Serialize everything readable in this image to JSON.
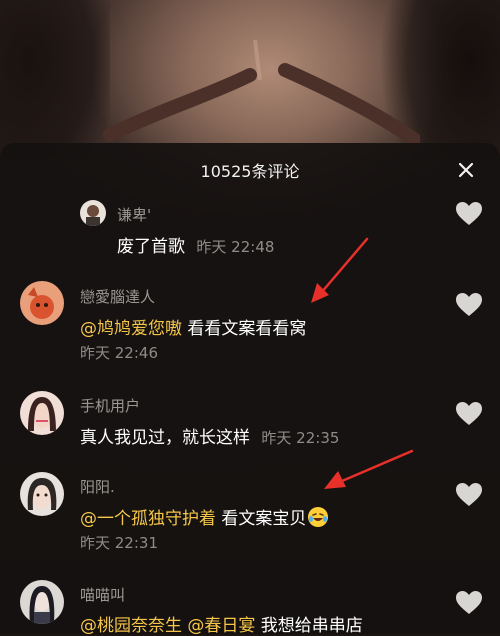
{
  "header": {
    "title": "10525条评论",
    "close_icon": "close-icon"
  },
  "comments": [
    {
      "user": "谦卑'",
      "parts": [
        {
          "text": "废了首歌",
          "mention": false
        }
      ],
      "time": "昨天 22:48",
      "time_inline": true
    },
    {
      "user": "戀愛腦達人",
      "parts": [
        {
          "text": "@鸠鸠爱您嗷",
          "mention": true
        },
        {
          "text": " 看看文案看看窝",
          "mention": false
        }
      ],
      "time": "昨天 22:46",
      "time_inline": false
    },
    {
      "user": "手机用户",
      "parts": [
        {
          "text": "真人我见过，就长这样",
          "mention": false
        }
      ],
      "time": "昨天 22:35",
      "time_inline": true
    },
    {
      "user": "阳阳.",
      "parts": [
        {
          "text": "@一个孤独守护着",
          "mention": true
        },
        {
          "text": " 看文案宝贝",
          "mention": false
        }
      ],
      "time": "昨天 22:31",
      "time_inline": false,
      "emoji": "laughing-tears-emoji"
    },
    {
      "user": "喵喵叫",
      "parts": [
        {
          "text": "@桃园奈奈生",
          "mention": true
        },
        {
          "text": " ",
          "mention": false
        },
        {
          "text": "@春日宴",
          "mention": true
        },
        {
          "text": " 我想给串串店",
          "mention": false
        }
      ]
    }
  ],
  "colors": {
    "mention": "#f5c64a",
    "annotation_arrow": "#e8302a",
    "like_icon": "#d8d6d3"
  }
}
